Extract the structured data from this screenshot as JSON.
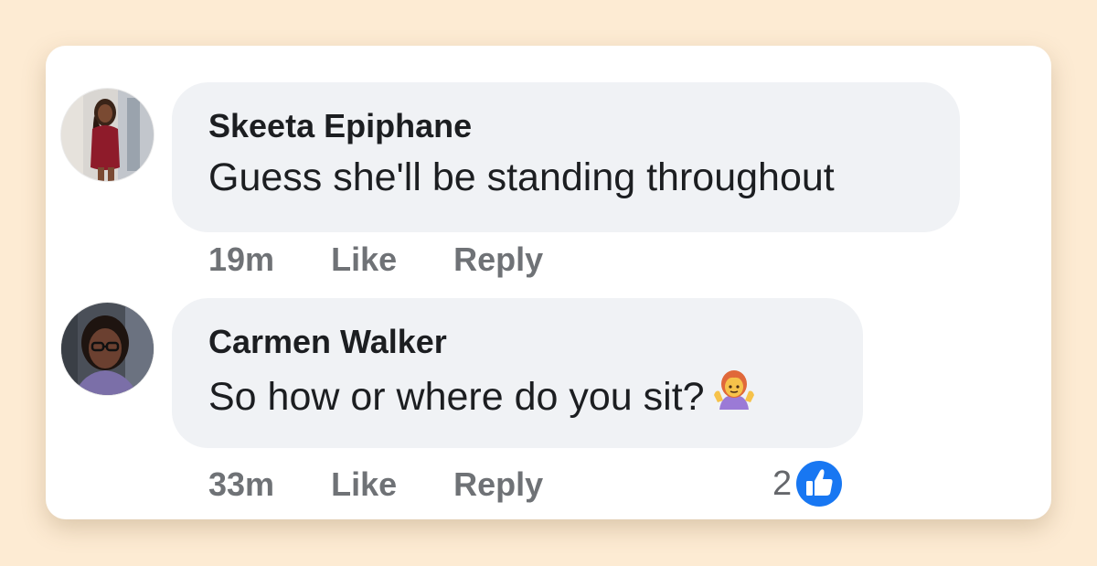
{
  "comments": [
    {
      "author": "Skeeta Epiphane",
      "text": "Guess she'll be standing throughout",
      "time": "19m",
      "like_label": "Like",
      "reply_label": "Reply",
      "avatar_icon": "profile-photo"
    },
    {
      "author": "Carmen Walker",
      "text": "So how or where do you sit?",
      "emoji": "person-shrugging-emoji",
      "time": "33m",
      "like_label": "Like",
      "reply_label": "Reply",
      "reaction_count": "2",
      "reaction_icon": "thumbs-up-icon",
      "avatar_icon": "profile-photo"
    }
  ],
  "colors": {
    "page_background": "#fdebd3",
    "card_background": "#ffffff",
    "bubble_background": "#f0f2f5",
    "text_primary": "#1c1e21",
    "text_secondary": "#6f7276",
    "like_blue": "#1877f2"
  }
}
